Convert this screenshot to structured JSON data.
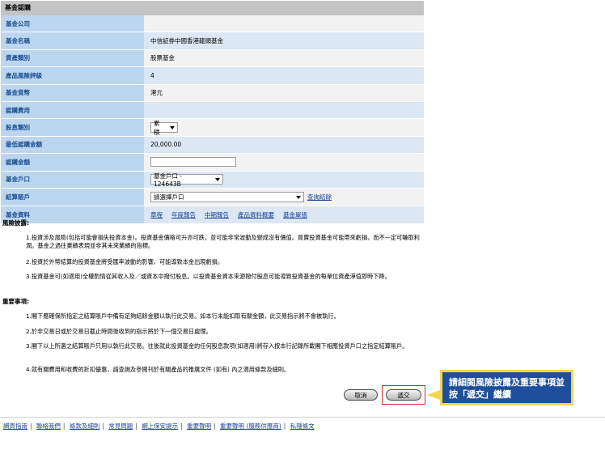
{
  "form": {
    "header": "基金認購",
    "rows": [
      {
        "label": "基金公司",
        "value": ""
      },
      {
        "label": "基金名稱",
        "value": "中信証券中國香港龍頭基金"
      },
      {
        "label": "資產類別",
        "value": "股票基金"
      },
      {
        "label": "產品風險評級",
        "value": "4"
      },
      {
        "label": "基金貨幣",
        "value": "港元"
      },
      {
        "label": "認購費用",
        "value": ""
      },
      {
        "label": "股息類別",
        "value": "累積"
      },
      {
        "label": "最低認購金額",
        "value": "20,000.00"
      },
      {
        "label": "認購金額",
        "value": ""
      },
      {
        "label": "基金戶口",
        "value": "基金戶口 - 124643B"
      },
      {
        "label": "結算賬戶",
        "value": "請選擇戶口",
        "link": "查詢結餘"
      },
      {
        "label": "基金資料"
      }
    ],
    "doc_links": [
      "章程",
      "年度報告",
      "中期報告",
      "產品資料概要",
      "基金單張"
    ]
  },
  "risk": {
    "title": "風險披露:",
    "items": [
      "1.投資涉及風險(包括可能會損失投資本金)。投資基金價格可升亦可跌，並可能非常波動及變成沒有價值。買賣投資基金可能帶來虧損，而不一定可賺取利潤。基金之過往業績表現並非其未來業績的指標。",
      "2.投資於外幣結算的投資基金將受匯率波動的影響，可能導致本金出現虧損。",
      "3.投資基金可(如適用)全權酌情從其收入及／或資本中撥付股息。以投資基金資本來源撥付股息可能導致投資基金的每單位資產淨值即時下降。"
    ]
  },
  "notes": {
    "title": "重要事項:",
    "items": [
      "1.閣下應確保所指定之結算賬戶中備有足夠結餘金額以執行此交易。如本行未能扣取有關金額，此交易指示將不會被執行。",
      "2.於非交易日或於交易日截止時間後收到的指示將於下一個交易日處理。",
      "3.閣下以上所選之結算賬戶只用以執行此交易。往後就此投資基金的任何股息款項(如適用)將存入按本行記錄所載閣下相應投資戶口之指定結算賬戶。",
      "4.就有關費用和收費的折扣優惠，請查詢及參閱刊於有關產品的推廣文件 (如有) 內之適用條款及細則。"
    ]
  },
  "buttons": {
    "cancel": "取消",
    "submit": "遞交"
  },
  "callout": {
    "text": "請細閱風險披露及重要事項並按「遞交」繼續"
  },
  "footer": {
    "links": [
      "網頁指南",
      "聯絡我們",
      "條款及細則",
      "常見問題",
      "網上保安提示",
      "重要聲明",
      "重要聲明 (服務供應商)",
      "私隱條文"
    ]
  },
  "colors": {
    "label_bg": "#bcd6ef",
    "label_text": "#1a4f8f",
    "callout_bg": "#1f4f9a",
    "callout_border": "#f3d64d"
  }
}
